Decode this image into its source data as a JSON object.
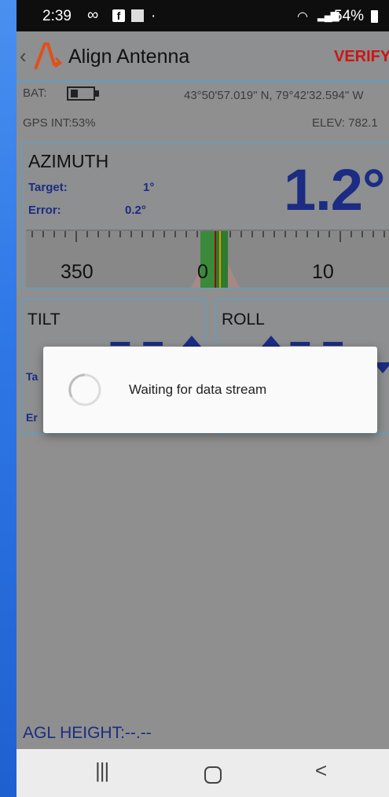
{
  "status_bar": {
    "time": "2:39",
    "battery": "54%"
  },
  "app_bar": {
    "title": "Align Antenna",
    "action": "VERIFY"
  },
  "info": {
    "bat_label": "BAT:",
    "coordinates": "43°50'57.019\" N,  79°42'32.594\" W",
    "gps_int": "GPS INT:53%",
    "elevation": "ELEV: 782.1"
  },
  "azimuth": {
    "title": "AZIMUTH",
    "value": "1.2°",
    "target_label": "Target:",
    "target_value": "1°",
    "error_label": "Error:",
    "error_value": "0.2°",
    "scale_labels": [
      "350",
      "0",
      "10"
    ]
  },
  "tilt": {
    "title": "TILT",
    "target_label_partial": "Ta",
    "error_label_partial": "Er"
  },
  "roll": {
    "title": "ROLL"
  },
  "agl": {
    "label": "AGL HEIGHT:--.--"
  },
  "dialog": {
    "message": "Waiting for data stream"
  },
  "colors": {
    "accent_blue": "#1b2c82",
    "verify_red": "#cc1515",
    "panel_border": "#6e9ab3",
    "dim_overlay": "#8f8f8f"
  }
}
